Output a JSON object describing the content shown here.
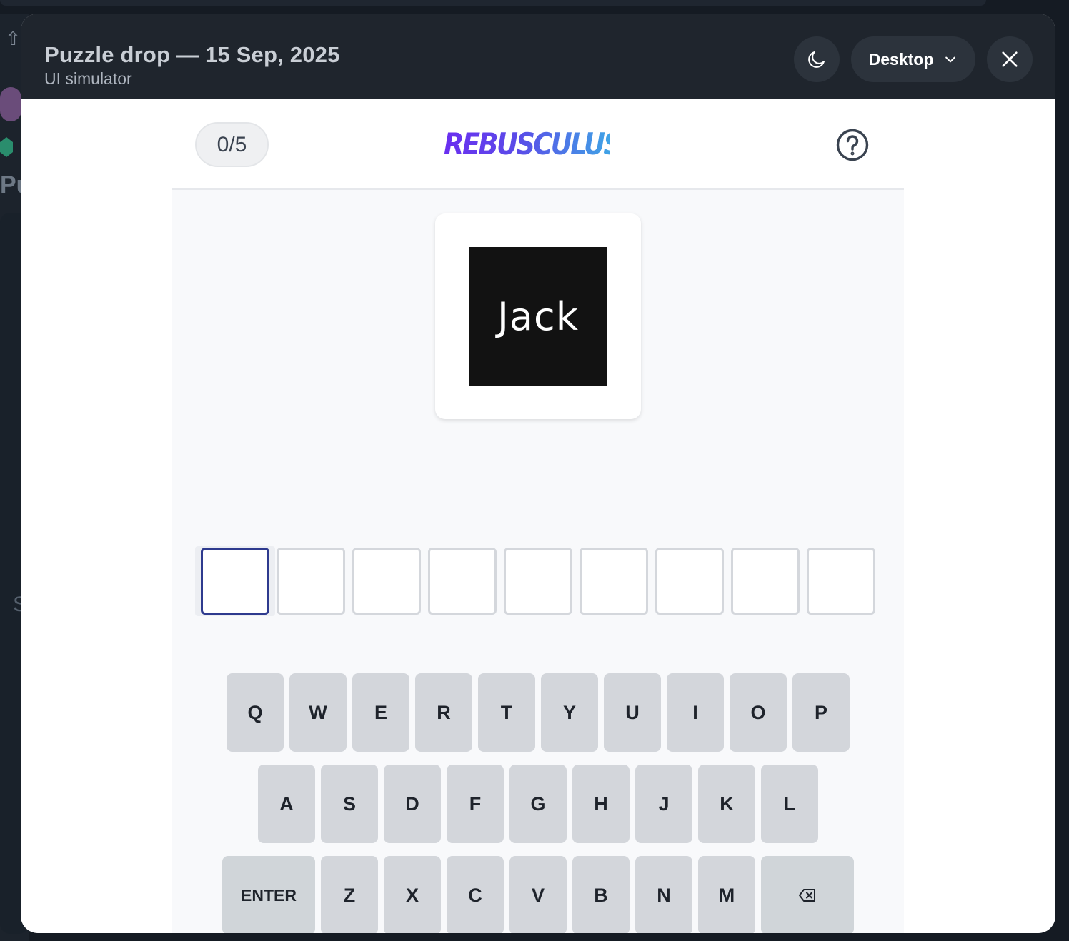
{
  "modal": {
    "title": "Puzzle drop — 15 Sep, 2025",
    "subtitle": "UI simulator",
    "device_label": "Desktop",
    "icons": {
      "theme": "moon-icon",
      "device_dropdown": "chevron-down-icon",
      "close": "close-icon"
    }
  },
  "game": {
    "score": "0/5",
    "logo_text": "REBUSCULUS",
    "help_icon": "question-circle-icon",
    "puzzle_word": "Jack",
    "answer_length": 9,
    "active_slot": 0
  },
  "keyboard": {
    "row1": [
      "Q",
      "W",
      "E",
      "R",
      "T",
      "Y",
      "U",
      "I",
      "O",
      "P"
    ],
    "row2": [
      "A",
      "S",
      "D",
      "F",
      "G",
      "H",
      "J",
      "K",
      "L"
    ],
    "row3": [
      "ENTER",
      "Z",
      "X",
      "C",
      "V",
      "B",
      "N",
      "M",
      "backspace"
    ],
    "backspace_icon": "backspace-icon"
  },
  "colors": {
    "header_bg": "#1f252d",
    "active_slot_border": "#2e3a8e",
    "key_bg": "#d3d6db",
    "logo_gradient": [
      "#6a2ef0",
      "#3fa3e6"
    ]
  }
}
